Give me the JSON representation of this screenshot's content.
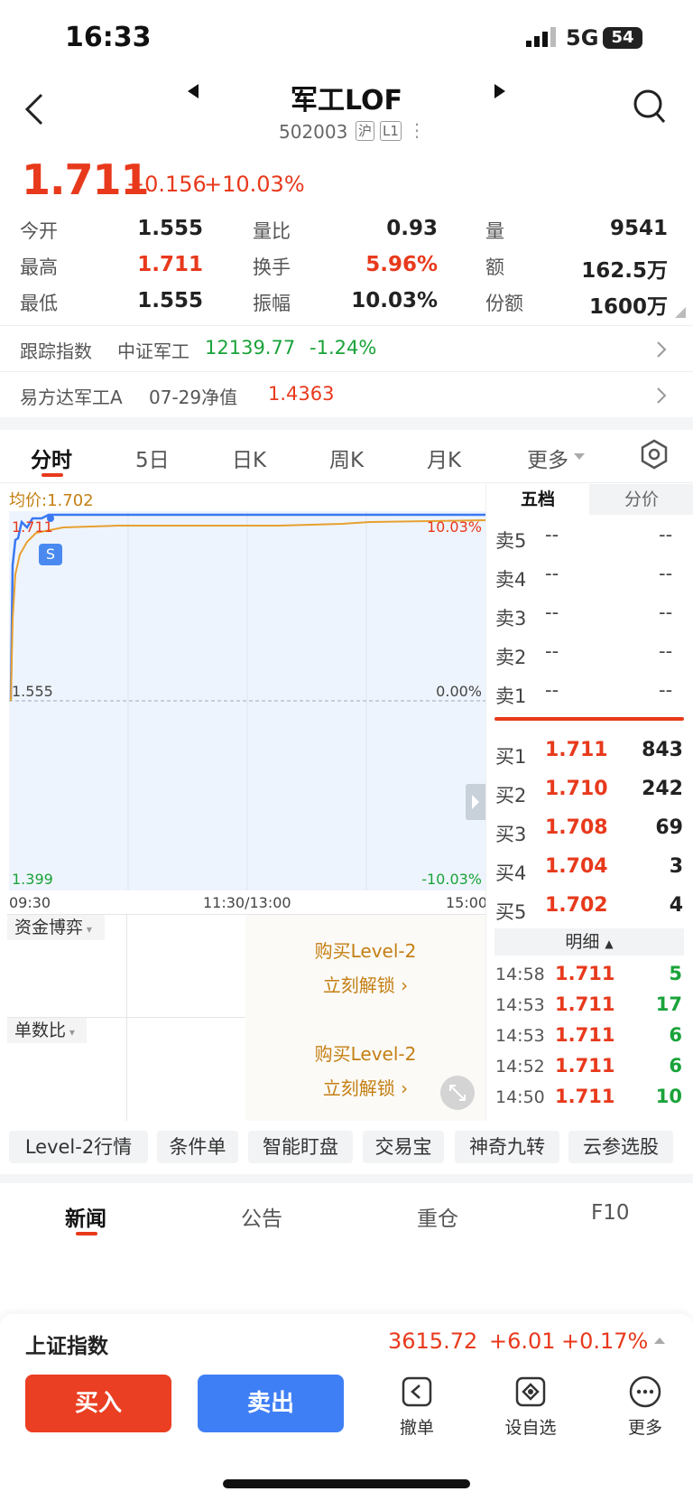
{
  "status_bar": {
    "time": "16:33",
    "network": "5G",
    "battery": "54"
  },
  "header": {
    "title": "军工LOF",
    "code": "502003",
    "exchange_badge": "沪",
    "level_badge": "L1",
    "more": "⋮"
  },
  "quote": {
    "price": "1.711",
    "change": "+0.156",
    "change_pct": "+10.03%"
  },
  "stats": [
    [
      {
        "label": "今开",
        "value": "1.555",
        "color": "dark"
      },
      {
        "label": "量比",
        "value": "0.93",
        "color": "dark"
      },
      {
        "label": "量",
        "value": "9541",
        "color": "dark"
      }
    ],
    [
      {
        "label": "最高",
        "value": "1.711",
        "color": "red"
      },
      {
        "label": "换手",
        "value": "5.96%",
        "color": "red"
      },
      {
        "label": "额",
        "value": "162.5万",
        "color": "dark"
      }
    ],
    [
      {
        "label": "最低",
        "value": "1.555",
        "color": "dark"
      },
      {
        "label": "振幅",
        "value": "10.03%",
        "color": "dark"
      },
      {
        "label": "份额",
        "value": "1600万",
        "color": "dark"
      }
    ]
  ],
  "tracking": {
    "label": "跟踪指数",
    "index_name": "中证军工",
    "index_value": "12139.77",
    "index_change": "-1.24%"
  },
  "nav": {
    "fund_name": "易方达军工A",
    "date_label": "07-29净值",
    "value": "1.4363"
  },
  "chart_tabs": [
    "分时",
    "5日",
    "日K",
    "周K",
    "月K",
    "更多"
  ],
  "chart": {
    "avg_label": "均价:1.702",
    "price_high": "1.711",
    "pct_high": "10.03%",
    "price_mid": "1.555",
    "pct_mid": "0.00%",
    "price_low": "1.399",
    "pct_low": "-10.03%",
    "time_start": "09:30",
    "time_mid": "11:30/13:00",
    "time_end": "15:00",
    "marker": "S",
    "colors": {
      "price_line": "#3a78f2",
      "avg_line": "#e8a030",
      "fill": "#eaf2fd"
    }
  },
  "orderbook": {
    "tabs": [
      "五档",
      "分价"
    ],
    "asks": [
      {
        "label": "卖5",
        "price": "--",
        "vol": "--"
      },
      {
        "label": "卖4",
        "price": "--",
        "vol": "--"
      },
      {
        "label": "卖3",
        "price": "--",
        "vol": "--"
      },
      {
        "label": "卖2",
        "price": "--",
        "vol": "--"
      },
      {
        "label": "卖1",
        "price": "--",
        "vol": "--"
      }
    ],
    "bids": [
      {
        "label": "买1",
        "price": "1.711",
        "vol": "843"
      },
      {
        "label": "买2",
        "price": "1.710",
        "vol": "242"
      },
      {
        "label": "买3",
        "price": "1.708",
        "vol": "69"
      },
      {
        "label": "买4",
        "price": "1.704",
        "vol": "3"
      },
      {
        "label": "买5",
        "price": "1.702",
        "vol": "4"
      }
    ]
  },
  "ticks": {
    "title": "明细",
    "rows": [
      {
        "t": "14:58",
        "p": "1.711",
        "v": "5"
      },
      {
        "t": "14:53",
        "p": "1.711",
        "v": "17"
      },
      {
        "t": "14:53",
        "p": "1.711",
        "v": "6"
      },
      {
        "t": "14:52",
        "p": "1.711",
        "v": "6"
      },
      {
        "t": "14:50",
        "p": "1.711",
        "v": "10"
      }
    ]
  },
  "level2": {
    "panel1_title": "资金博弈",
    "panel2_title": "单数比",
    "promo_line1": "购买Level-2",
    "promo_line2": "立刻解锁"
  },
  "tools": [
    "Level-2行情",
    "条件单",
    "智能盯盘",
    "交易宝",
    "神奇九转",
    "云参选股"
  ],
  "news_tabs": [
    "新闻",
    "公告",
    "重仓",
    "F10"
  ],
  "index_bar": {
    "name": "上证指数",
    "value": "3615.72",
    "change": "+6.01",
    "pct": "+0.17%"
  },
  "bottom": {
    "buy": "买入",
    "sell": "卖出",
    "cancel": "撤单",
    "watch": "设自选",
    "more": "更多"
  }
}
